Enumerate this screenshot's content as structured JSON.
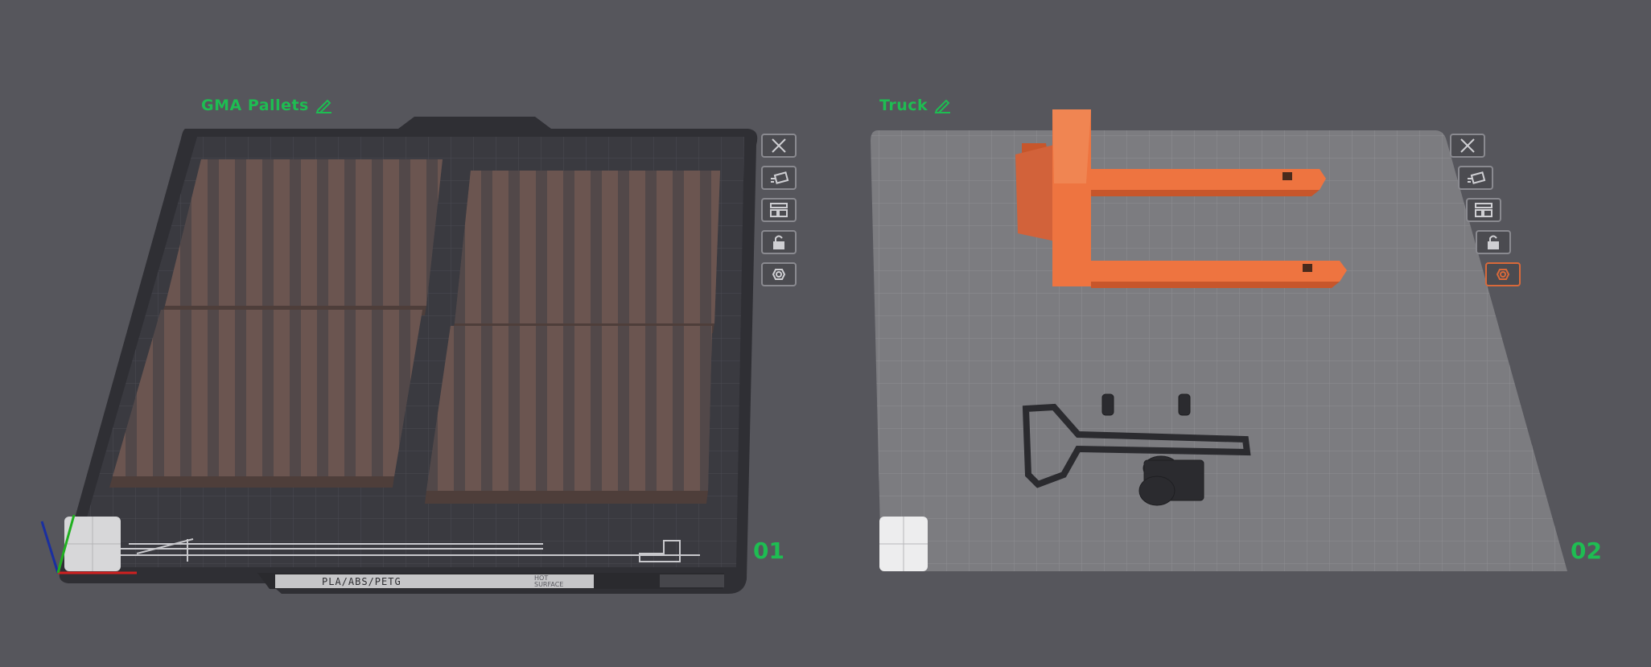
{
  "plates": [
    {
      "name": "GMA Pallets",
      "index": "01",
      "material_label": "PLA/ABS/PETG",
      "surface_label_1": "HOT",
      "surface_label_2": "SURFACE",
      "tools": [
        {
          "name": "close-plate",
          "icon": "close-icon"
        },
        {
          "name": "auto-orient",
          "icon": "orient-icon"
        },
        {
          "name": "arrange",
          "icon": "arrange-icon"
        },
        {
          "name": "lock",
          "icon": "lock-icon"
        },
        {
          "name": "plate-settings",
          "icon": "settings-icon"
        }
      ]
    },
    {
      "name": "Truck",
      "index": "02",
      "tools": [
        {
          "name": "close-plate",
          "icon": "close-icon"
        },
        {
          "name": "auto-orient",
          "icon": "orient-icon"
        },
        {
          "name": "arrange",
          "icon": "arrange-icon"
        },
        {
          "name": "lock",
          "icon": "lock-icon"
        },
        {
          "name": "plate-settings",
          "icon": "settings-icon",
          "active": true
        }
      ]
    }
  ],
  "colors": {
    "background": "#56565c",
    "plate_dark": "#3a3a40",
    "plate_light": "#7c7c80",
    "pallet": "#6b5550",
    "truck_orange": "#ee7440",
    "truck_handle": "#2b2b2f",
    "accent_green": "#1ebd52"
  }
}
